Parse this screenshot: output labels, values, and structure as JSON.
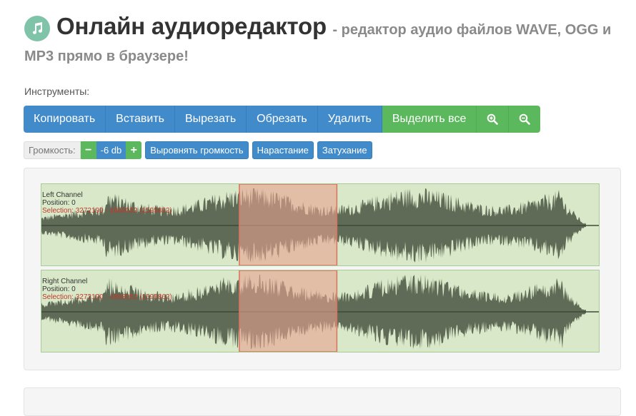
{
  "header": {
    "logo_icon": "music-note-icon",
    "title": "Онлайн аудиоредактор",
    "subtitle": "- редактор аудио файлов WAVE, OGG и",
    "subtitle_cont": "MP3 прямо в браузере!"
  },
  "tools_label": "Инструменты:",
  "toolbar": {
    "copy": "Копировать",
    "paste": "Вставить",
    "cut": "Вырезать",
    "crop": "Обрезать",
    "delete": "Удалить",
    "select_all": "Выделить все",
    "zoom_in_icon": "zoom-in-icon",
    "zoom_out_icon": "zoom-out-icon"
  },
  "volume": {
    "label": "Громкость:",
    "minus": "−",
    "value": "-6 db",
    "plus": "+",
    "normalize": "Выровнять громкость",
    "fade_in": "Нарастание",
    "fade_out": "Затухание"
  },
  "channels": [
    {
      "name": "Left Channel",
      "position": "Position: 0",
      "selection": "Selection: 3272190 - 4868052 (1595862)"
    },
    {
      "name": "Right Channel",
      "position": "Position: 0",
      "selection": "Selection: 3272190 - 4868052 (1595862)"
    }
  ],
  "selection_fraction": {
    "start": 0.355,
    "end": 0.53
  },
  "colors": {
    "primary": "#428bca",
    "success": "#5cb85c",
    "waveform": "#5f6b56",
    "waveform_bg": "#d9e8c8",
    "selection": "#e8a291",
    "selection_text": "#c0392b"
  }
}
